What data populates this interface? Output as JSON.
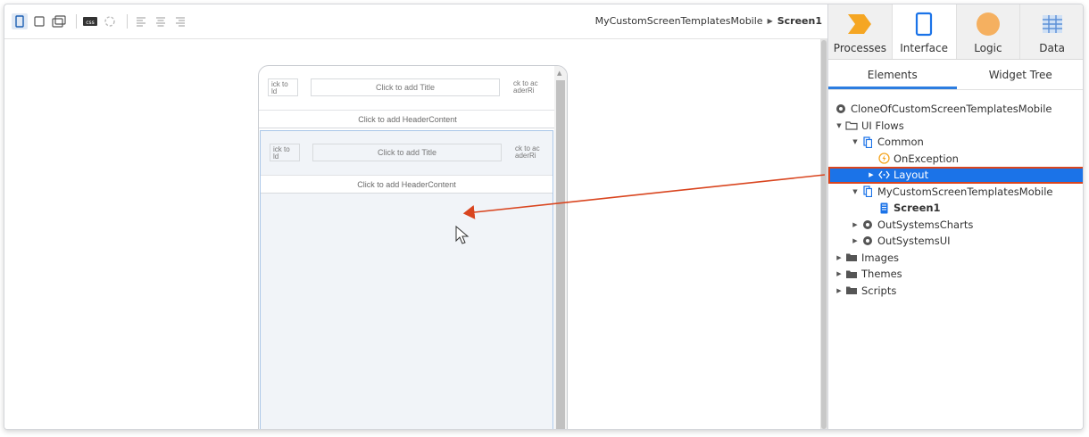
{
  "breadcrumb": {
    "module": "MyCustomScreenTemplatesMobile",
    "screen": "Screen1"
  },
  "toolbar": {
    "buttons": [
      "phone-view",
      "tablet-view",
      "tablet-landscape-view",
      "css",
      "widget-tree-toggle",
      "align-left",
      "align-center",
      "align-right"
    ]
  },
  "canvas": {
    "headers": [
      {
        "left": "ick to\nld",
        "title": "Click to add Title",
        "right": "ck to ac\naderRi",
        "content": "Click to add HeaderContent"
      },
      {
        "left": "ick to\nld",
        "title": "Click to add Title",
        "right": "ck to ac\naderRi",
        "content": "Click to add HeaderContent"
      }
    ]
  },
  "panel": {
    "tabs": [
      {
        "label": "Processes",
        "icon": "processes-icon",
        "color": "#f5a623"
      },
      {
        "label": "Interface",
        "icon": "interface-icon",
        "color": "#1b73e8"
      },
      {
        "label": "Logic",
        "icon": "logic-icon",
        "color": "#f5a623"
      },
      {
        "label": "Data",
        "icon": "data-icon",
        "color": "#5b8fd6"
      }
    ],
    "subtabs": [
      "Elements",
      "Widget Tree"
    ],
    "tree": [
      {
        "label": "CloneOfCustomScreenTemplatesMobile",
        "icon": "module-icon"
      },
      {
        "label": "UI Flows",
        "icon": "folder-open-icon"
      },
      {
        "label": "Common",
        "icon": "flow-icon"
      },
      {
        "label": "OnException",
        "icon": "exception-handler-icon"
      },
      {
        "label": "Layout",
        "icon": "block-icon"
      },
      {
        "label": "MyCustomScreenTemplatesMobile",
        "icon": "flow-icon"
      },
      {
        "label": "Screen1",
        "icon": "screen-icon"
      },
      {
        "label": "OutSystemsCharts",
        "icon": "module-icon"
      },
      {
        "label": "OutSystemsUI",
        "icon": "module-icon"
      },
      {
        "label": "Images",
        "icon": "folder-icon"
      },
      {
        "label": "Themes",
        "icon": "folder-icon"
      },
      {
        "label": "Scripts",
        "icon": "folder-icon"
      }
    ]
  },
  "colors": {
    "selection": "#1b73e8",
    "annotation_arrow": "#d9451f",
    "drop_area": "#f1f4f8"
  }
}
